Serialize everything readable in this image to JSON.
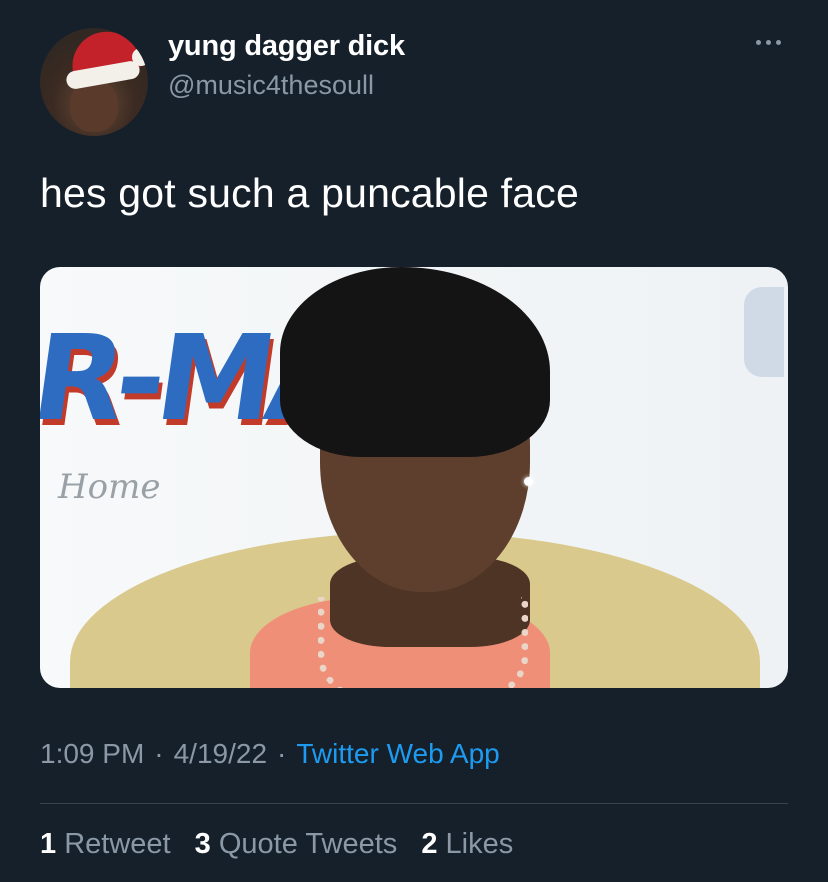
{
  "user": {
    "display_name": "yung dagger dick",
    "handle": "@music4thesoull"
  },
  "tweet": {
    "text": "hes got such a puncable face",
    "time": "1:09 PM",
    "date": "4/19/22",
    "source": "Twitter Web App",
    "separator": "·"
  },
  "stats": {
    "retweets": {
      "count": "1",
      "label": "Retweet"
    },
    "quotes": {
      "count": "3",
      "label": "Quote Tweets"
    },
    "likes": {
      "count": "2",
      "label": "Likes"
    }
  },
  "media": {
    "poster_text": "R-MA",
    "poster_subtext": "Home"
  },
  "colors": {
    "background": "#15202b",
    "secondary_text": "#8b98a5",
    "link": "#1d9bf0",
    "divider": "#38444d"
  },
  "icons": {
    "more": "more-horizontal-icon"
  }
}
